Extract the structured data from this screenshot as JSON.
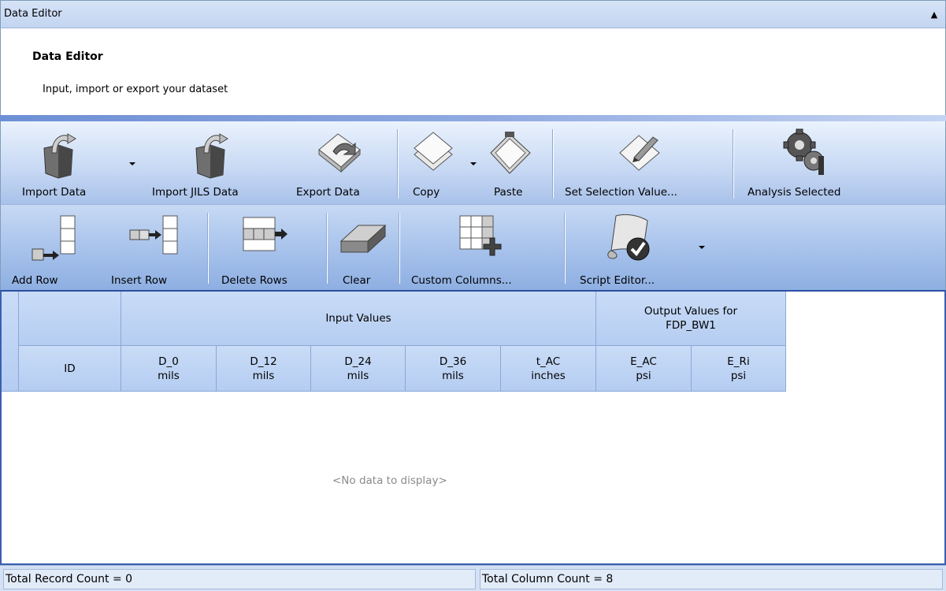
{
  "titlebar": {
    "title": "Data Editor",
    "collapse_icon": "collapse-up-icon"
  },
  "header": {
    "title": "Data Editor",
    "description": "Input, import or export your dataset"
  },
  "toolbar1": {
    "import_data": "Import Data",
    "import_jils": "Import JILS Data",
    "export_data": "Export Data",
    "copy": "Copy",
    "paste": "Paste",
    "set_selection": "Set Selection Value...",
    "analysis_selected": "Analysis Selected"
  },
  "toolbar2": {
    "add_row": "Add Row",
    "insert_row": "Insert Row",
    "delete_rows": "Delete Rows",
    "clear": "Clear",
    "custom_columns": "Custom Columns...",
    "script_editor": "Script Editor..."
  },
  "grid": {
    "group_input": "Input Values",
    "group_output_line1": "Output Values for",
    "group_output_line2": "FDP_BW1",
    "columns": [
      {
        "name": "ID",
        "unit": ""
      },
      {
        "name": "D_0",
        "unit": "mils"
      },
      {
        "name": "D_12",
        "unit": "mils"
      },
      {
        "name": "D_24",
        "unit": "mils"
      },
      {
        "name": "D_36",
        "unit": "mils"
      },
      {
        "name": "t_AC",
        "unit": "inches"
      },
      {
        "name": "E_AC",
        "unit": "psi"
      },
      {
        "name": "E_Ri",
        "unit": "psi"
      }
    ],
    "empty_message": "<No data to display>"
  },
  "status": {
    "record_count": "Total Record Count = 0",
    "column_count": "Total Column Count = 8"
  },
  "colors": {
    "accent": "#3a5fb0",
    "header_cell": "#c9dcf7",
    "toolbar": "#c9daf4"
  }
}
